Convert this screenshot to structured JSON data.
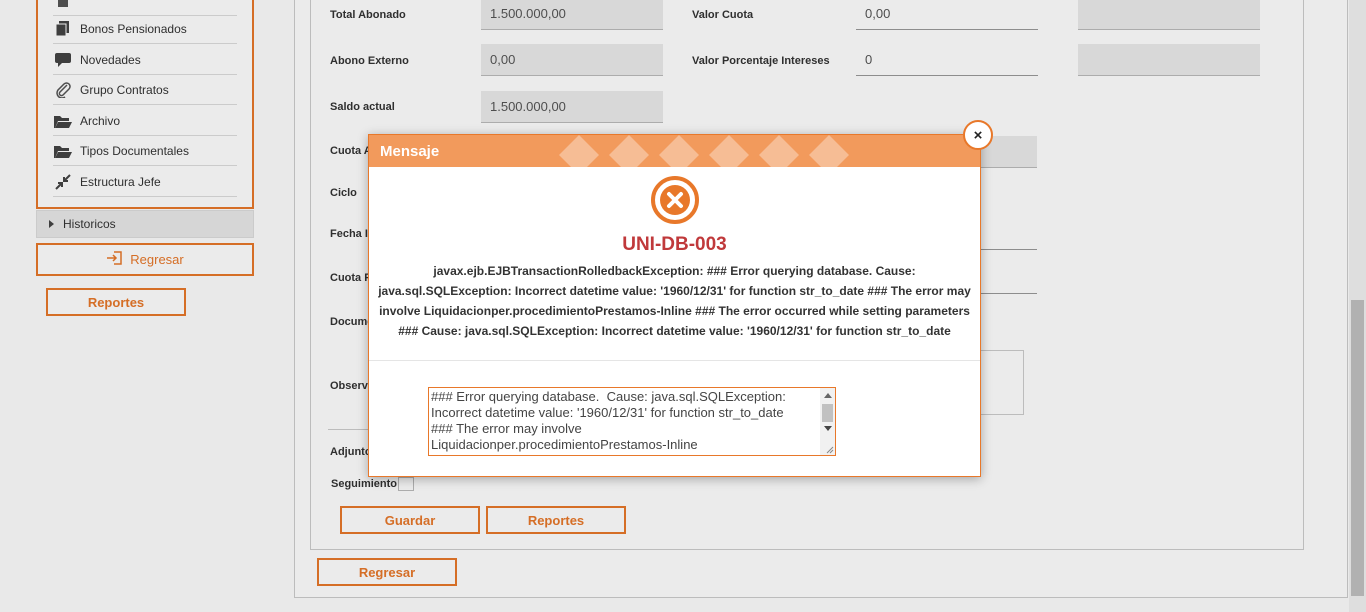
{
  "sidebar": {
    "items": [
      {
        "label": "Bonos Pensionados",
        "icon": "copy-icon"
      },
      {
        "label": "Novedades",
        "icon": "comment-icon"
      },
      {
        "label": "Grupo Contratos",
        "icon": "paperclip-icon"
      },
      {
        "label": "Archivo",
        "icon": "folder-open-icon"
      },
      {
        "label": "Tipos Documentales",
        "icon": "folder-open-icon"
      },
      {
        "label": "Estructura Jefe",
        "icon": "compress-icon"
      }
    ],
    "historicos_label": "Historicos",
    "regresar_label": "Regresar",
    "reportes_label": "Reportes"
  },
  "form": {
    "total_abonado_label": "Total Abonado",
    "total_abonado_value": "1.500.000,00",
    "valor_cuota_label": "Valor Cuota",
    "valor_cuota_value": "0,00",
    "abono_externo_label": "Abono Externo",
    "abono_externo_value": "0,00",
    "valor_porcentaje_label": "Valor Porcentaje Intereses",
    "valor_porcentaje_value": "0",
    "saldo_actual_label": "Saldo actual",
    "saldo_actual_value": "1.500.000,00",
    "cuota_a_label": "Cuota A",
    "ciclo_label": "Ciclo",
    "fecha_label": "Fecha I",
    "cuota_f_label": "Cuota F",
    "documento_label": "Docume",
    "observ_label": "Observ",
    "adjunto_label": "Adjunto",
    "seguimiento_label": "Seguimiento",
    "guardar_label": "Guardar",
    "reportes_label": "Reportes",
    "regresar_label": "Regresar"
  },
  "modal": {
    "title": "Mensaje",
    "close_glyph": "×",
    "error_code": "UNI-DB-003",
    "message": "javax.ejb.EJBTransactionRolledbackException: ### Error querying database. Cause: java.sql.SQLException: Incorrect datetime value: '1960/12/31' for function str_to_date ### The error may involve Liquidacionper.procedimientoPrestamos-Inline ### The error occurred while setting parameters ### Cause: java.sql.SQLException: Incorrect datetime value: '1960/12/31' for function str_to_date",
    "detail_text": "### Error querying database.  Cause: java.sql.SQLException: Incorrect datetime value: '1960/12/31' for function str_to_date\n### The error may involve Liquidacionper.procedimientoPrestamos-Inline",
    "error_icon": "error-circle-x-icon"
  },
  "colors": {
    "accent": "#e8782a",
    "header": "#f29a5c",
    "error_code": "#c0393b"
  }
}
